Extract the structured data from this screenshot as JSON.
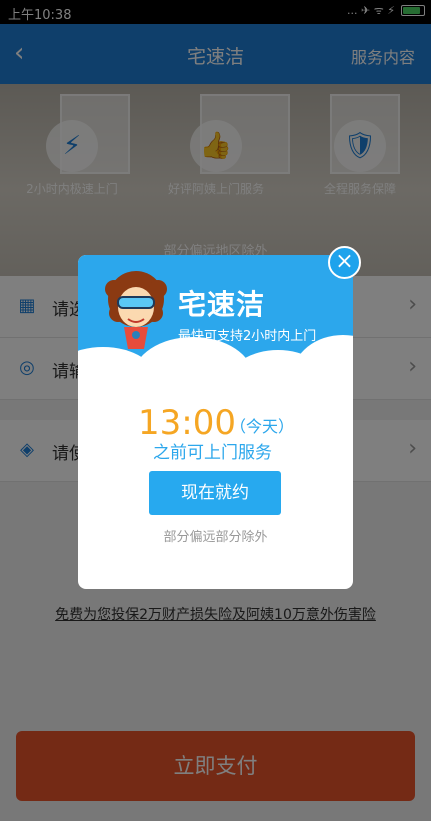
{
  "status_bar": {
    "time": "上午10:38",
    "icons": "... ✈ ᯤ ⚡"
  },
  "navbar": {
    "back_icon": "‹",
    "title": "宅速洁",
    "right_label": "服务内容"
  },
  "hero": {
    "badges": [
      {
        "icon": "⚡",
        "label": "2小时内极速上门"
      },
      {
        "icon": "👍",
        "label": "好评阿姨上门服务"
      },
      {
        "icon": "🛡",
        "label": "全程服务保障"
      }
    ],
    "note": "部分偏远地区除外"
  },
  "form": {
    "rows": [
      {
        "icon": "▦",
        "label": "请选择服务时间"
      },
      {
        "icon": "◎",
        "label": "请输入服务地址"
      },
      {
        "icon": "◈",
        "label": "请使用优惠券"
      }
    ]
  },
  "insurance": "免费为您投保2万财产损失险及阿姨10万意外伤害险",
  "pay_button": "立即支付",
  "dialog": {
    "brand": "宅速洁",
    "slogan": "最快可支持2小时内上门",
    "time": "13:00",
    "today": "（今天）",
    "before": "之前可上门服务",
    "book_button": "现在就约",
    "except": "部分偏远部分除外",
    "close_icon": "×"
  }
}
